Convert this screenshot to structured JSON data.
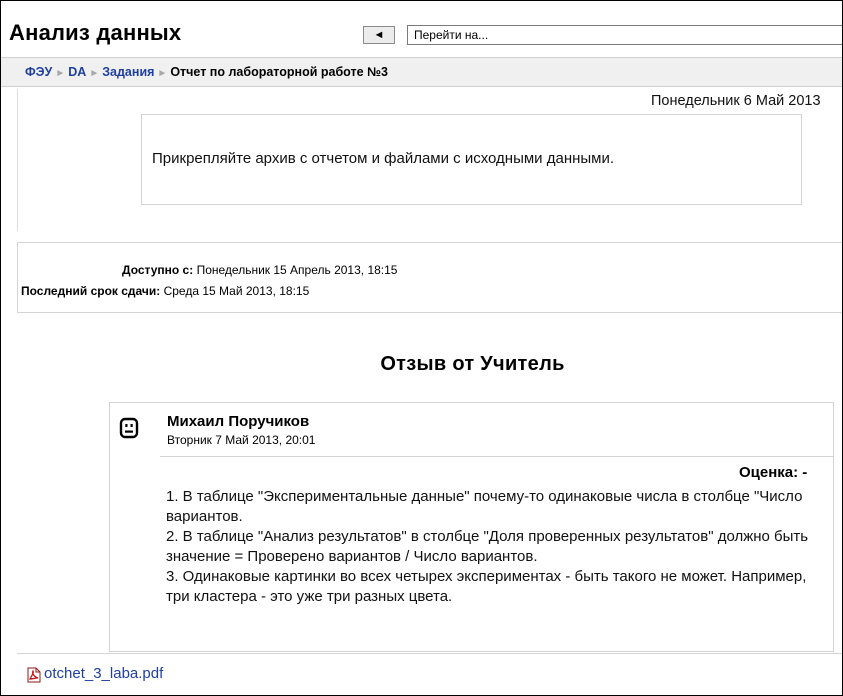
{
  "header": {
    "title": "Анализ данных",
    "back_button": "◄",
    "jump_select": "Перейти на..."
  },
  "breadcrumb": {
    "items": [
      "ФЭУ",
      "DA",
      "Задания"
    ],
    "current": "Отчет по лабораторной работе №3",
    "separator": "►"
  },
  "assignment": {
    "date_top": "Понедельник 6 Май 2013",
    "description": "Прикрепляйте архив с отчетом и файлами с исходными данными.",
    "available_from_label": "Доступно с:",
    "available_from_value": "Понедельник 15 Апрель 2013, 18:15",
    "due_label": "Последний срок сдачи:",
    "due_value": "Среда 15 Май 2013, 18:15"
  },
  "feedback": {
    "heading": "Отзыв от Учитель",
    "teacher_name": "Михаил Поручиков",
    "date": "Вторник 7 Май 2013, 20:01",
    "grade": "Оценка: -",
    "comment_lines": [
      "1. В таблице \"Экспериментальные данные\" почему-то одинаковые числа в столбце \"Число вариантов.",
      "2. В таблице \"Анализ результатов\" в столбце \"Доля проверенных результатов\" должно быть значение = Проверено вариантов / Число вариантов.",
      "3. Одинаковые картинки во всех четырех экспериментах - быть такого не может. Например, три кластера - это уже три разных цвета."
    ]
  },
  "attachment": {
    "filename": "otchet_3_laba.pdf",
    "icon": "pdf-icon"
  },
  "colors": {
    "link": "#1f3f9e",
    "navbar_bg": "#f0f0f0",
    "border": "#d4d4d4"
  }
}
